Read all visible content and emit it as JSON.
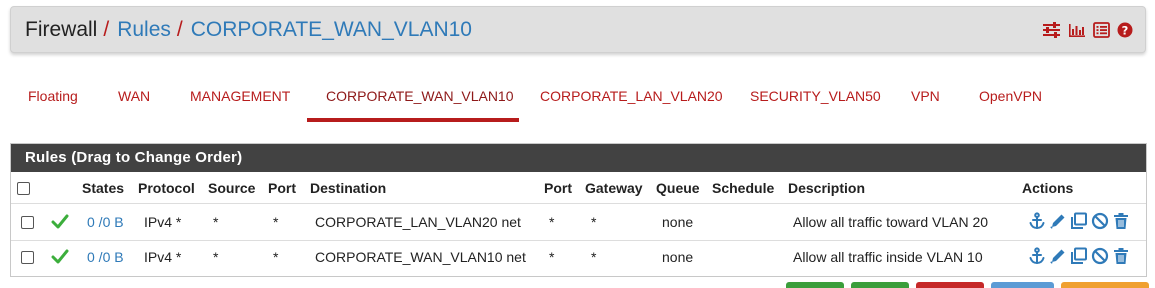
{
  "breadcrumb": {
    "root": "Firewall",
    "sep": "/",
    "rules": "Rules",
    "current": "CORPORATE_WAN_VLAN10"
  },
  "header_icons": [
    "sliders-icon",
    "bar-chart-icon",
    "list-icon",
    "help-icon"
  ],
  "tabs": [
    {
      "label": "Floating"
    },
    {
      "label": "WAN"
    },
    {
      "label": "MANAGEMENT"
    },
    {
      "label": "CORPORATE_WAN_VLAN10",
      "active": true
    },
    {
      "label": "CORPORATE_LAN_VLAN20"
    },
    {
      "label": "SECURITY_VLAN50"
    },
    {
      "label": "VPN"
    },
    {
      "label": "OpenVPN"
    }
  ],
  "panel": {
    "title": "Rules (Drag to Change Order)",
    "columns": {
      "states": "States",
      "protocol": "Protocol",
      "source": "Source",
      "port": "Port",
      "destination": "Destination",
      "dport": "Port",
      "gateway": "Gateway",
      "queue": "Queue",
      "schedule": "Schedule",
      "description": "Description",
      "actions": "Actions"
    },
    "rows": [
      {
        "states": "0 /0 B",
        "protocol": "IPv4 *",
        "source": "*",
        "port": "*",
        "destination": "CORPORATE_LAN_VLAN20 net",
        "dport": "*",
        "gateway": "*",
        "queue": "none",
        "schedule": "",
        "description": "Allow all traffic toward VLAN 20"
      },
      {
        "states": "0 /0 B",
        "protocol": "IPv4 *",
        "source": "*",
        "port": "*",
        "destination": "CORPORATE_WAN_VLAN10 net",
        "dport": "*",
        "gateway": "*",
        "queue": "none",
        "schedule": "",
        "description": "Allow all traffic inside VLAN 10"
      }
    ]
  },
  "colors": {
    "accent_red": "#b71c1c",
    "link_blue": "#2f7ab8",
    "panel_head": "#424242",
    "pass_green": "#3cae3c"
  }
}
